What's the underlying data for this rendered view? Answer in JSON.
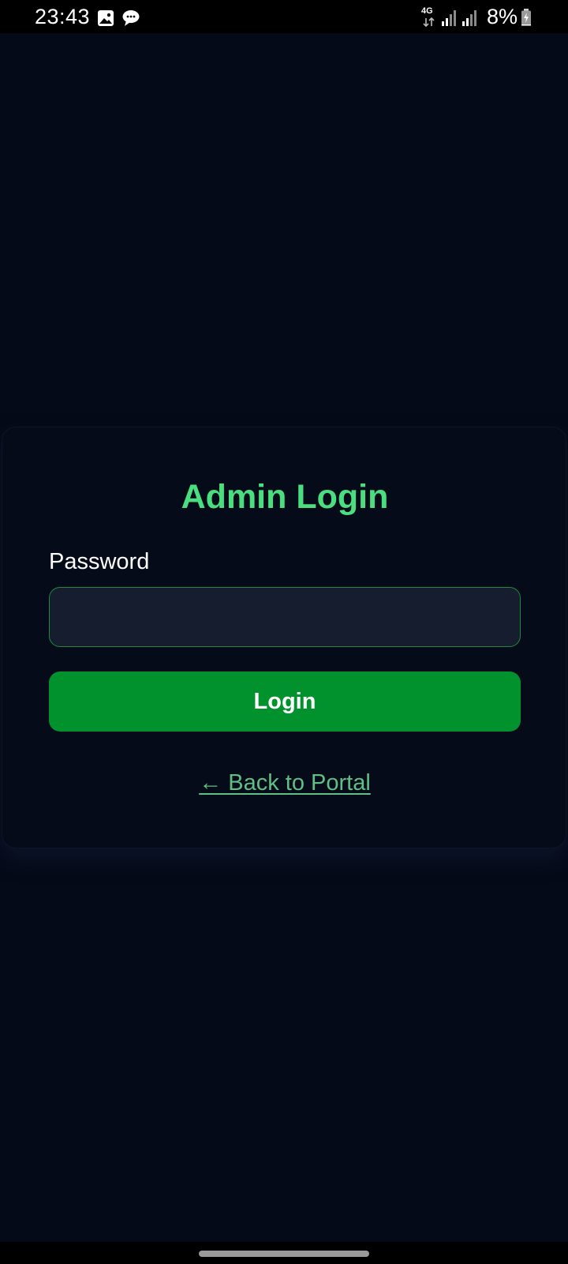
{
  "status_bar": {
    "time": "23:43",
    "notification_icons": [
      "image-icon",
      "chat-bubble-icon"
    ],
    "network_type": "4G",
    "battery_percent": "8%",
    "battery_level": 0.08,
    "battery_charging": true
  },
  "login": {
    "title": "Admin Login",
    "password_label": "Password",
    "password_value": "",
    "password_placeholder": "",
    "login_button_label": "Login",
    "back_link_label": "← Back to Portal"
  },
  "colors": {
    "background": "#040a18",
    "accent_green": "#4ade80",
    "button_green": "#02922d",
    "input_background": "#151d2e",
    "link_green": "#5fbf85"
  }
}
